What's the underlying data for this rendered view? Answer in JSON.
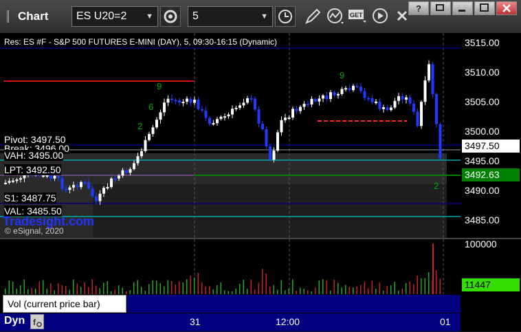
{
  "window": {
    "title": "Chart"
  },
  "toolbar": {
    "symbol": "ES U20=2",
    "interval": "5"
  },
  "chart": {
    "header": "ES #F - S&P 500 FUTURES E-MINI (DAY), 5, 09:30-16:15 (Dynamic)",
    "header_prefix": "Res:",
    "yaxis": [
      "3515.00",
      "3510.00",
      "3505.00",
      "3500.00",
      "3495.00",
      "3490.00",
      "3485.00"
    ],
    "last_price": "3497.50",
    "price_tag": "3492.63",
    "levels": {
      "pivot": "Pivot: 3497.50",
      "break": "Break: 3496.00",
      "vah": "VAH: 3495.00",
      "lpt": "LPT: 3492.50",
      "s1": "S1: 3487.75",
      "val": "VAL: 3485.50"
    },
    "watermark": "Tradesight.com",
    "copyright": "© eSignal, 2020",
    "count_labels": [
      "9",
      "6",
      "2",
      "9",
      "2"
    ],
    "xaxis": [
      "31",
      "12:00",
      "01"
    ]
  },
  "volume": {
    "yaxis": "100000",
    "value": "11447",
    "label": "Vol (current price bar)"
  },
  "footer": {
    "label": "Dyn"
  },
  "colors": {
    "up": "#ffffff",
    "down": "#1e3cff",
    "green": "#008000",
    "lime": "#33dd00",
    "navy": "#000080"
  }
}
